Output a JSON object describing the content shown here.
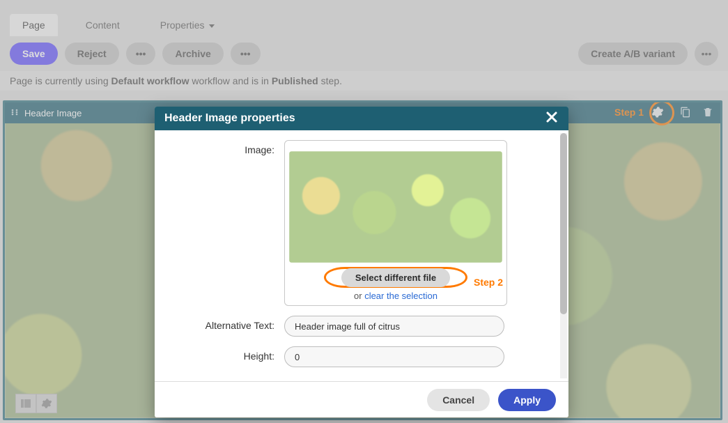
{
  "tabs": {
    "page": "Page",
    "content": "Content",
    "properties": "Properties"
  },
  "toolbar": {
    "save": "Save",
    "reject": "Reject",
    "archive": "Archive",
    "create_ab": "Create A/B variant"
  },
  "workflow_line": {
    "prefix": "Page is currently using ",
    "workflow_name": "Default workflow",
    "mid": " workflow and is in ",
    "step_name": "Published",
    "suffix": " step."
  },
  "widget": {
    "title": "Header Image"
  },
  "annotations": {
    "step1": "Step 1",
    "step2": "Step 2"
  },
  "modal": {
    "title": "Header Image properties",
    "labels": {
      "image": "Image:",
      "alt": "Alternative Text:",
      "height": "Height:"
    },
    "select_different": "Select different file",
    "clear_prefix": "or ",
    "clear_link": "clear the selection",
    "alt_value": "Header image full of citrus",
    "height_value": "0",
    "cancel": "Cancel",
    "apply": "Apply"
  }
}
